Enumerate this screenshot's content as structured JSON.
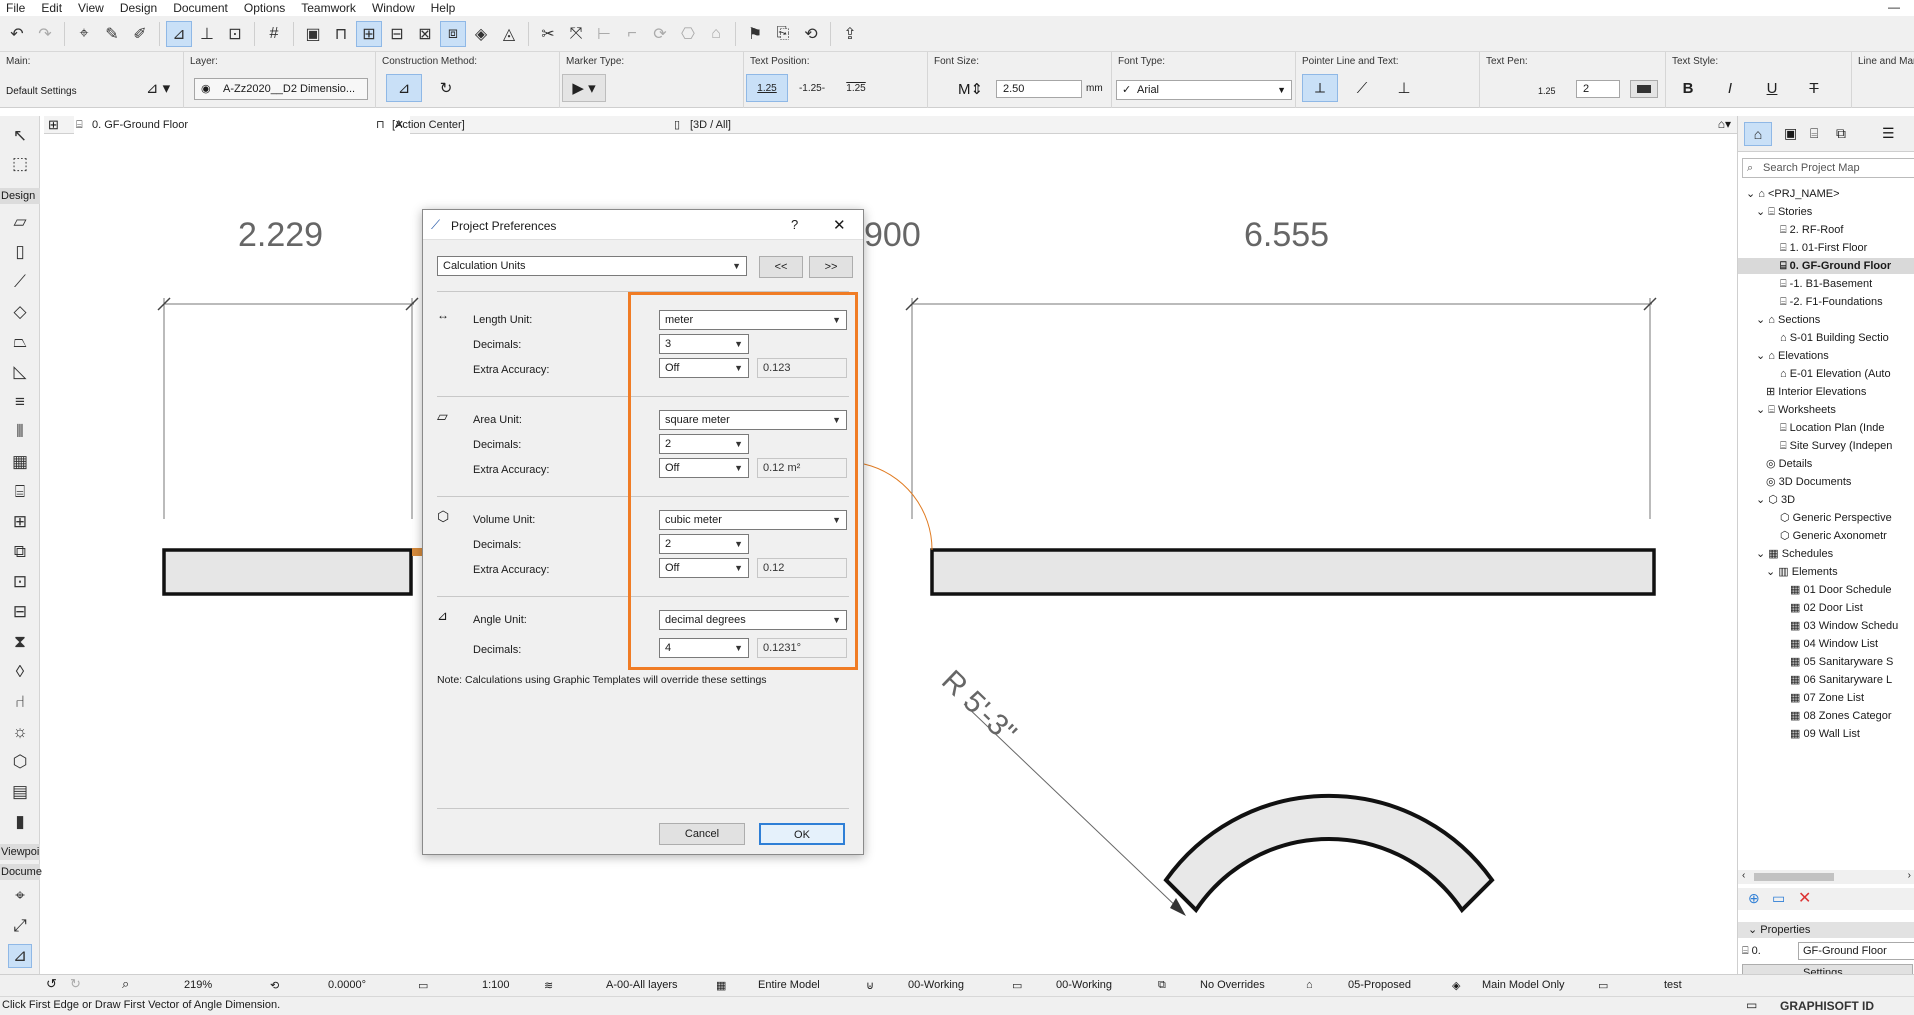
{
  "menu": [
    "File",
    "Edit",
    "View",
    "Design",
    "Document",
    "Options",
    "Teamwork",
    "Window",
    "Help"
  ],
  "infobox": {
    "main_label": "Main:",
    "main_value": "Default Settings",
    "layer_label": "Layer:",
    "layer_value": "A-Zz2020__D2 Dimensio...",
    "construction_label": "Construction Method:",
    "marker_label": "Marker Type:",
    "text_position_label": "Text Position:",
    "text_position_options": [
      "1.25",
      "-1.25-",
      "1.25"
    ],
    "font_size_label": "Font Size:",
    "font_size_value": "2.50",
    "font_size_unit": "mm",
    "font_type_label": "Font Type:",
    "font_type_value": "Arial",
    "pointer_label": "Pointer Line and Text:",
    "text_pen_label": "Text Pen:",
    "text_pen_prefix": "1.25",
    "text_pen_value": "2",
    "text_style_label": "Text Style:",
    "line_marker_label": "Line and Marke"
  },
  "tabs": {
    "floor": "0. GF-Ground Floor",
    "action": "[Action Center]",
    "view3d": "[3D / All]"
  },
  "left_panel": {
    "design": "Design",
    "viewpoint": "Viewpoi",
    "document": "Docume"
  },
  "canvas": {
    "dim1": "2.229",
    "dim2": "900",
    "dim3": "6.555",
    "radius": "R 5'-3\""
  },
  "dialog": {
    "title": "Project Preferences",
    "help": "?",
    "category": "Calculation Units",
    "prev": "<<",
    "next": ">>",
    "length_label": "Length Unit:",
    "length_value": "meter",
    "length_dec_label": "Decimals:",
    "length_dec_value": "3",
    "length_extra_label": "Extra Accuracy:",
    "length_extra_value": "Off",
    "length_preview": "0.123",
    "area_label": "Area Unit:",
    "area_value": "square meter",
    "area_dec_label": "Decimals:",
    "area_dec_value": "2",
    "area_extra_label": "Extra Accuracy:",
    "area_extra_value": "Off",
    "area_preview": "0.12 m²",
    "volume_label": "Volume Unit:",
    "volume_value": "cubic meter",
    "volume_dec_label": "Decimals:",
    "volume_dec_value": "2",
    "volume_extra_label": "Extra Accuracy:",
    "volume_extra_value": "Off",
    "volume_preview": "0.12",
    "angle_label": "Angle Unit:",
    "angle_value": "decimal degrees",
    "angle_dec_label": "Decimals:",
    "angle_dec_value": "4",
    "angle_preview": "0.1231°",
    "note": "Note: Calculations using Graphic Templates will override these settings",
    "cancel": "Cancel",
    "ok": "OK",
    "highlight_color": "#f07c25"
  },
  "navigator": {
    "search_placeholder": "Search Project Map",
    "items": [
      "<PRJ_NAME>",
      "Stories",
      "2. RF-Roof",
      "1. 01-First Floor",
      "0. GF-Ground Floor",
      "-1. B1-Basement",
      "-2. F1-Foundations",
      "Sections",
      "S-01 Building Sectio",
      "Elevations",
      "E-01 Elevation (Auto",
      "Interior Elevations",
      "Worksheets",
      "Location Plan (Inde",
      "Site Survey (Indepen",
      "Details",
      "3D Documents",
      "3D",
      "Generic Perspective",
      "Generic Axonometr",
      "Schedules",
      "Elements",
      "01 Door Schedule",
      "02 Door List",
      "03 Window Schedu",
      "04 Window List",
      "05 Sanitaryware S",
      "06 Sanitaryware L",
      "07 Zone List",
      "08 Zones Categor",
      "09 Wall List"
    ],
    "properties_label": "Properties",
    "prop_id": "0.",
    "prop_value": "GF-Ground Floor",
    "settings": "Settings..."
  },
  "status": {
    "zoom": "219%",
    "angle": "0.0000°",
    "scale": "1:100",
    "layers": "A-00-All layers",
    "model": "Entire Model",
    "pen": "00-Working",
    "graphic": "00-Working",
    "overrides": "No Overrides",
    "renovation": "05-Proposed",
    "mvo": "Main Model Only",
    "test": "test"
  },
  "footer": {
    "hint": "Click First Edge or Draw First Vector of Angle Dimension.",
    "brand": "GRAPHISOFT ID"
  }
}
